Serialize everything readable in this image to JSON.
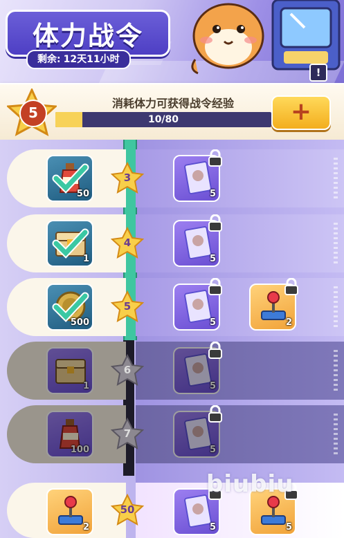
{
  "header": {
    "title": "体力战令",
    "remaining_label": "剩余:",
    "remaining_value": "12天11小时",
    "info_icon": "!"
  },
  "level_bar": {
    "level": "5",
    "exp_hint": "消耗体力可获得战令经验",
    "progress_text": "10/80",
    "progress_fraction": 0.125,
    "plus_label": "+"
  },
  "rows": [
    {
      "level": "3",
      "free_reward": {
        "icon": "bottle",
        "count": "50",
        "claimed": true
      },
      "paid_rewards": [
        {
          "icon": "card-pack",
          "count": "5",
          "locked": true
        }
      ]
    },
    {
      "level": "4",
      "free_reward": {
        "icon": "chest",
        "count": "1",
        "claimed": true
      },
      "paid_rewards": [
        {
          "icon": "card-pack",
          "count": "5",
          "locked": true
        }
      ]
    },
    {
      "level": "5",
      "free_reward": {
        "icon": "coin",
        "count": "500",
        "claimed": true
      },
      "paid_rewards": [
        {
          "icon": "card-pack",
          "count": "5",
          "locked": true
        },
        {
          "icon": "joystick",
          "count": "2",
          "locked": true
        }
      ]
    },
    {
      "level": "6",
      "free_reward": {
        "icon": "chest",
        "count": "1",
        "claimed": false
      },
      "paid_rewards": [
        {
          "icon": "card-pack",
          "count": "5",
          "locked": true
        }
      ]
    },
    {
      "level": "7",
      "free_reward": {
        "icon": "bottle",
        "count": "100",
        "claimed": false
      },
      "paid_rewards": [
        {
          "icon": "card-pack",
          "count": "5",
          "locked": true
        }
      ]
    }
  ],
  "final_row": {
    "level": "50",
    "free_reward": {
      "icon": "joystick",
      "count": "2"
    },
    "paid_rewards": [
      {
        "icon": "card-pack",
        "count": "5"
      },
      {
        "icon": "joystick",
        "count": "5"
      }
    ]
  },
  "watermark": "biubiu",
  "colors": {
    "accent_purple": "#5b4fd0",
    "progress_fill": "#f7d258",
    "track_green": "#3fc6a0",
    "plus_orange": "#f3ae1e"
  }
}
